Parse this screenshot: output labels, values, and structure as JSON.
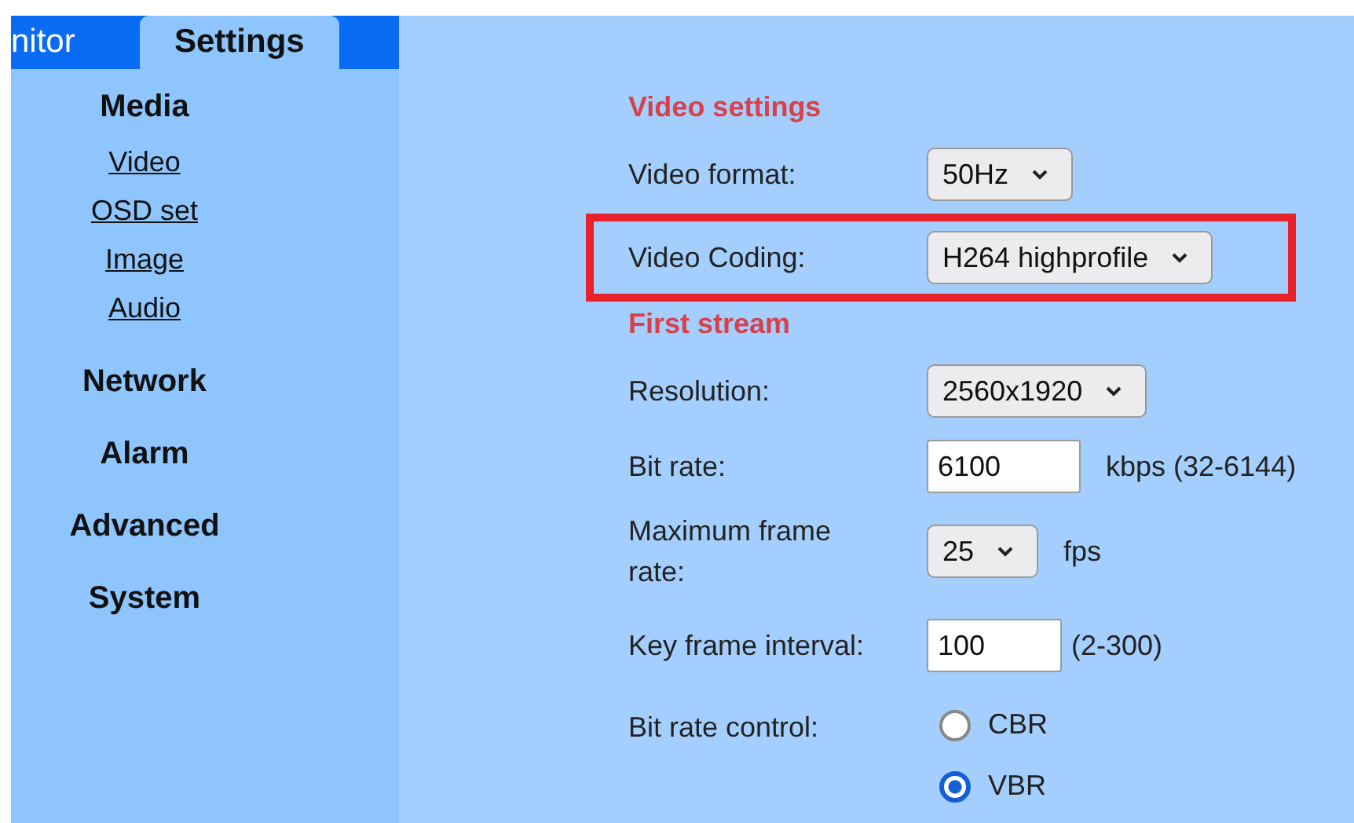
{
  "tabs": [
    {
      "label": "nitor",
      "selected": false
    },
    {
      "label": "Settings",
      "selected": true
    }
  ],
  "sidebar": {
    "sections": [
      {
        "title": "Media",
        "items": [
          "Video",
          "OSD set",
          "Image",
          "Audio"
        ]
      },
      {
        "title": "Network"
      },
      {
        "title": "Alarm"
      },
      {
        "title": "Advanced"
      },
      {
        "title": "System"
      }
    ]
  },
  "form": {
    "sections": [
      {
        "title": "Video settings",
        "rows": [
          {
            "kind": "select",
            "label": "Video format:",
            "value": "50Hz",
            "highlighted": false
          },
          {
            "kind": "select",
            "label": "Video Coding:",
            "value": "H264 highprofile",
            "highlighted": true
          }
        ]
      },
      {
        "title": "First stream",
        "rows": [
          {
            "kind": "select",
            "label": "Resolution:",
            "value": "2560x1920",
            "highlighted": false
          },
          {
            "kind": "input",
            "label": "Bit rate:",
            "value": "6100",
            "suffix": "kbps (32-6144)",
            "highlighted": false
          },
          {
            "kind": "select",
            "label": "Maximum frame rate:",
            "value": "25",
            "suffix": "fps",
            "highlighted": false
          },
          {
            "kind": "input",
            "label": "Key frame interval:",
            "value": "100",
            "suffix": "(2-300)",
            "highlighted": false
          },
          {
            "kind": "radio",
            "label": "Bit rate control:",
            "options": [
              {
                "label": "CBR",
                "selected": false
              },
              {
                "label": "VBR",
                "selected": true
              }
            ],
            "highlighted": false
          }
        ]
      }
    ]
  }
}
